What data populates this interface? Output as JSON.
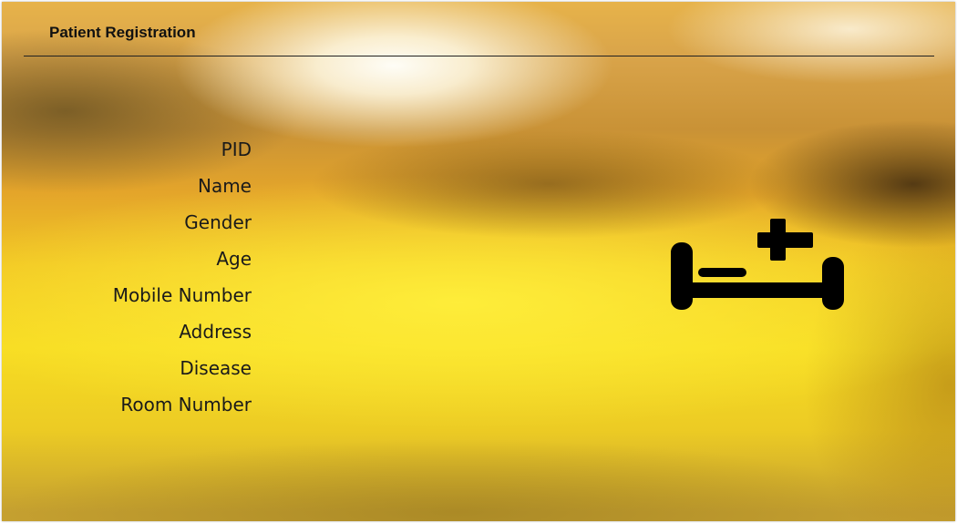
{
  "window": {
    "title": "Patient Registration"
  },
  "form": {
    "labels": [
      "PID",
      "Name",
      "Gender",
      "Age",
      "Mobile Number",
      "Address",
      "Disease",
      "Room Number"
    ]
  },
  "illustration": {
    "icon": "hospital-bed-icon",
    "color": "#000000"
  },
  "colors": {
    "background": "#f2c824",
    "divider": "#222222",
    "text": "#111111"
  }
}
